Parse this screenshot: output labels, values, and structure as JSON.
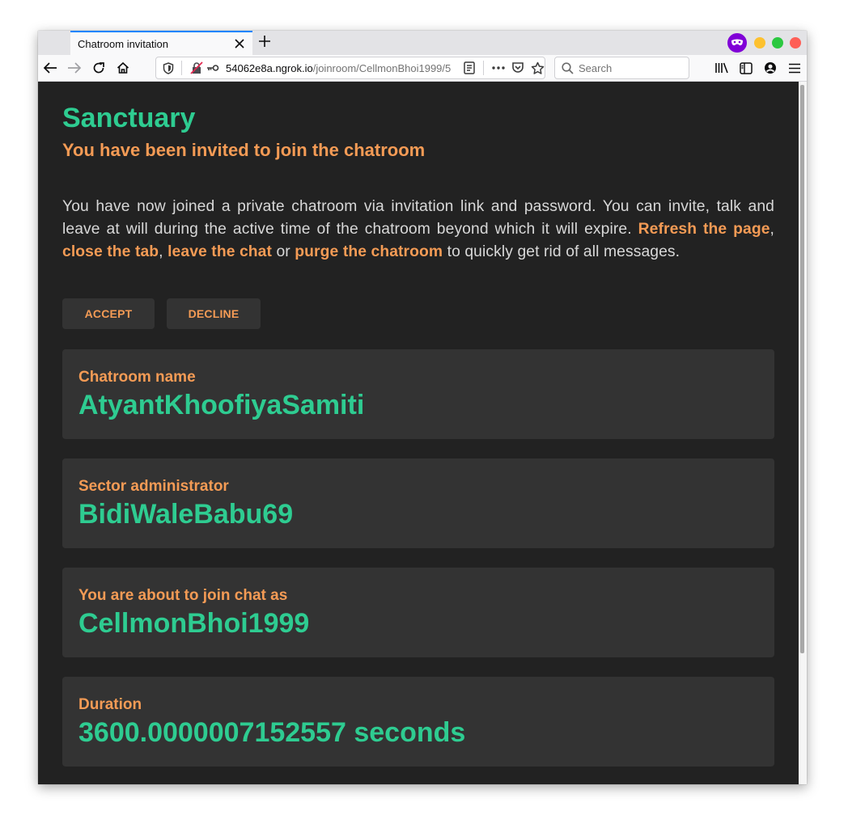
{
  "browser": {
    "tab_title": "Chatroom invitation",
    "url_host": "54062e8a.ngrok.io",
    "url_path": "/joinroom/CellmonBhoi1999/5",
    "search_placeholder": "Search",
    "icons": {
      "back": "arrow-left-icon",
      "forward": "arrow-right-icon",
      "reload": "reload-icon",
      "home": "home-icon",
      "tracking": "shield-icon",
      "insecure": "lock-crossed-icon",
      "key": "key-icon",
      "reader": "reader-view-icon",
      "more": "ellipsis-icon",
      "pocket": "pocket-icon",
      "bookmark": "star-icon",
      "library": "library-icon",
      "sidebar": "sidebar-icon",
      "account": "account-icon",
      "menu": "hamburger-icon",
      "private": "private-browsing-icon"
    }
  },
  "page": {
    "title": "Sanctuary",
    "subtitle": "You have been invited to join the chatroom",
    "intro": {
      "text1": "You have now joined a private chatroom via invitation link and password. You can invite, talk and leave at will during the active time of the chatroom beyond which it will expire. ",
      "link_refresh": "Refresh the page",
      "sep1": ", ",
      "link_close": "close the tab",
      "sep2": ", ",
      "link_leave": "leave the chat",
      "sep3": " or ",
      "link_purge": "purge the chatroom",
      "text2": " to quickly get rid of all messages."
    },
    "buttons": {
      "accept": "ACCEPT",
      "decline": "DECLINE"
    },
    "cards": [
      {
        "label": "Chatroom name",
        "value": "AtyantKhoofiyaSamiti"
      },
      {
        "label": "Sector administrator",
        "value": "BidiWaleBabu69"
      },
      {
        "label": "You are about to join chat as",
        "value": "CellmonBhoi1999"
      },
      {
        "label": "Duration",
        "value": "3600.0000007152557 seconds"
      }
    ]
  },
  "colors": {
    "accent_green": "#2ecc91",
    "accent_orange": "#f49b55",
    "background": "#222222",
    "card": "#333333"
  }
}
